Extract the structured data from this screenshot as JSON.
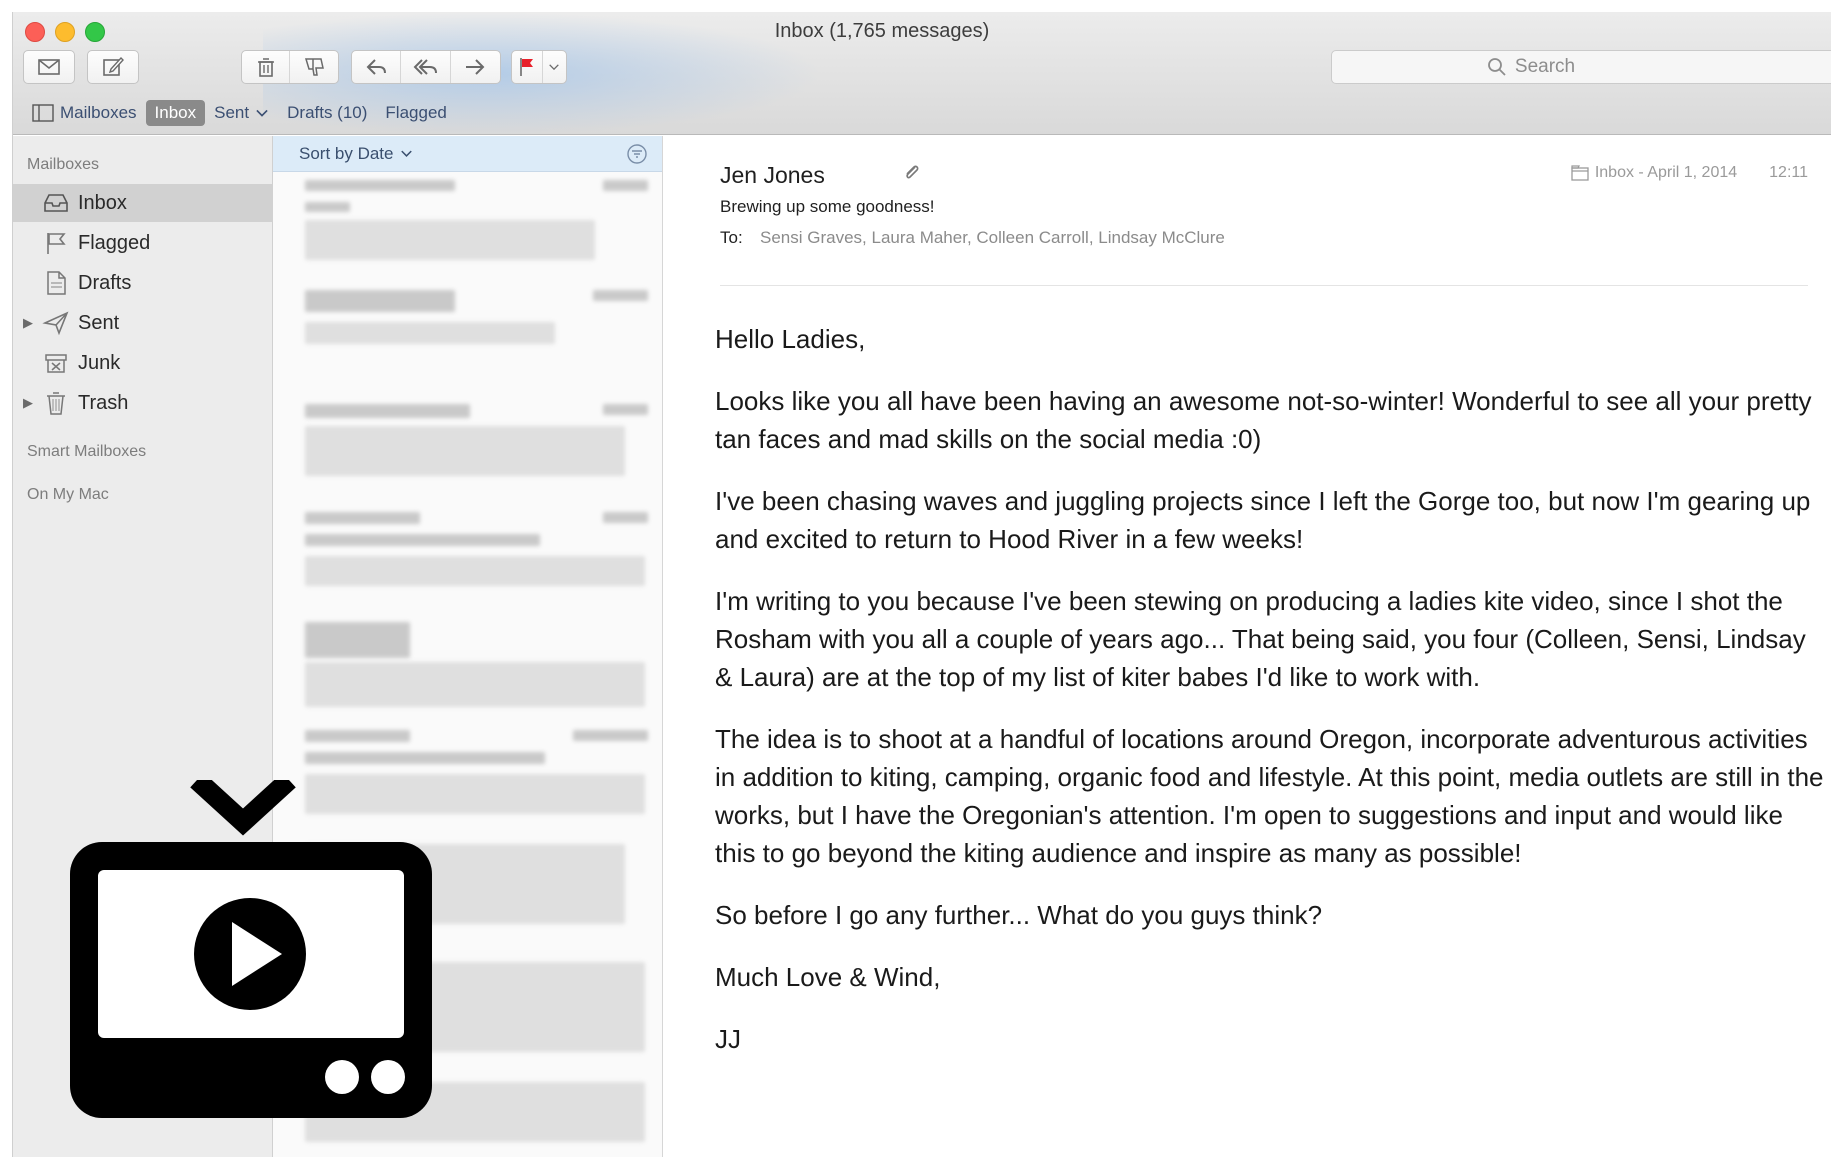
{
  "window": {
    "title": "Inbox (1,765 messages)"
  },
  "toolbar": {
    "buttons": [
      "get-mail",
      "compose",
      "delete",
      "junk",
      "reply",
      "reply-all",
      "forward",
      "flag",
      "flag-menu"
    ],
    "search_placeholder": "Search"
  },
  "favorites": {
    "mailboxes": "Mailboxes",
    "inbox": "Inbox",
    "sent": "Sent",
    "drafts": "Drafts (10)",
    "flagged": "Flagged"
  },
  "sidebar": {
    "heading_mailboxes": "Mailboxes",
    "items": [
      {
        "label": "Inbox",
        "icon": "inbox-icon",
        "selected": true
      },
      {
        "label": "Flagged",
        "icon": "flag-icon"
      },
      {
        "label": "Drafts",
        "icon": "drafts-icon"
      },
      {
        "label": "Sent",
        "icon": "sent-icon",
        "expandable": true
      },
      {
        "label": "Junk",
        "icon": "junk-icon"
      },
      {
        "label": "Trash",
        "icon": "trash-icon",
        "expandable": true
      }
    ],
    "heading_smart": "Smart Mailboxes",
    "heading_local": "On My Mac"
  },
  "message_list": {
    "sort_label": "Sort by Date"
  },
  "message": {
    "from": "Jen Jones",
    "subject": "Brewing up some goodness!",
    "to_label": "To:",
    "to": "Sensi Graves, Laura Maher, Colleen Carroll, Lindsay McClure",
    "mailbox_date": "Inbox - April 1, 2014",
    "time": "12:11",
    "body": [
      "Hello Ladies,",
      "Looks like you all have been having an awesome not-so-winter! Wonderful to see all your pretty tan faces and mad skills on the social media :0)",
      "I've been chasing waves and juggling projects since I left the Gorge too, but now I'm gearing up and excited to return to Hood River in a few weeks!",
      "I'm writing to you because I've been stewing on producing a ladies kite video, since I shot the Rosham with you all a couple of years ago... That being said, you four (Colleen, Sensi, Lindsay & Laura) are at the top of my list of kiter babes I'd like to work with.",
      "The idea is to shoot at a handful of locations around Oregon, incorporate adventurous activities in addition to kiting, camping, organic food and lifestyle. At this point, media outlets are still in the works, but I have the Oregonian's attention. I'm open to suggestions and input and would like this to go beyond the kiting audience and inspire as many as possible!",
      "So before I go any further... What do you guys think?",
      "Much Love & Wind,",
      "JJ"
    ]
  },
  "colors": {
    "accent": "#3b4f72",
    "sort_bar": "#dcebf8",
    "flag": "#e8202a",
    "overlay": "#000000"
  }
}
